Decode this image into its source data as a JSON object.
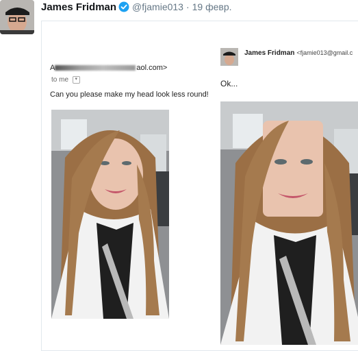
{
  "tweet": {
    "author_name": "James Fridman",
    "handle": "@fjamie013",
    "separator": "·",
    "date": "19 февр."
  },
  "left_email": {
    "sender_suffix": "aol.com>",
    "sender_prefix": "A",
    "recipient": "to me",
    "request": "Can you please make my head look less round!"
  },
  "right_email": {
    "reply_name": "James Fridman",
    "reply_email": "<fjamie013@gmail.c",
    "reply_text": "Ok..."
  },
  "icons": {
    "verified": "verified-badge-icon",
    "dropdown": "chevron-down-icon"
  },
  "colors": {
    "verified_blue": "#1da1f2",
    "secondary_text": "#657786",
    "hair": "#a57a4e"
  }
}
